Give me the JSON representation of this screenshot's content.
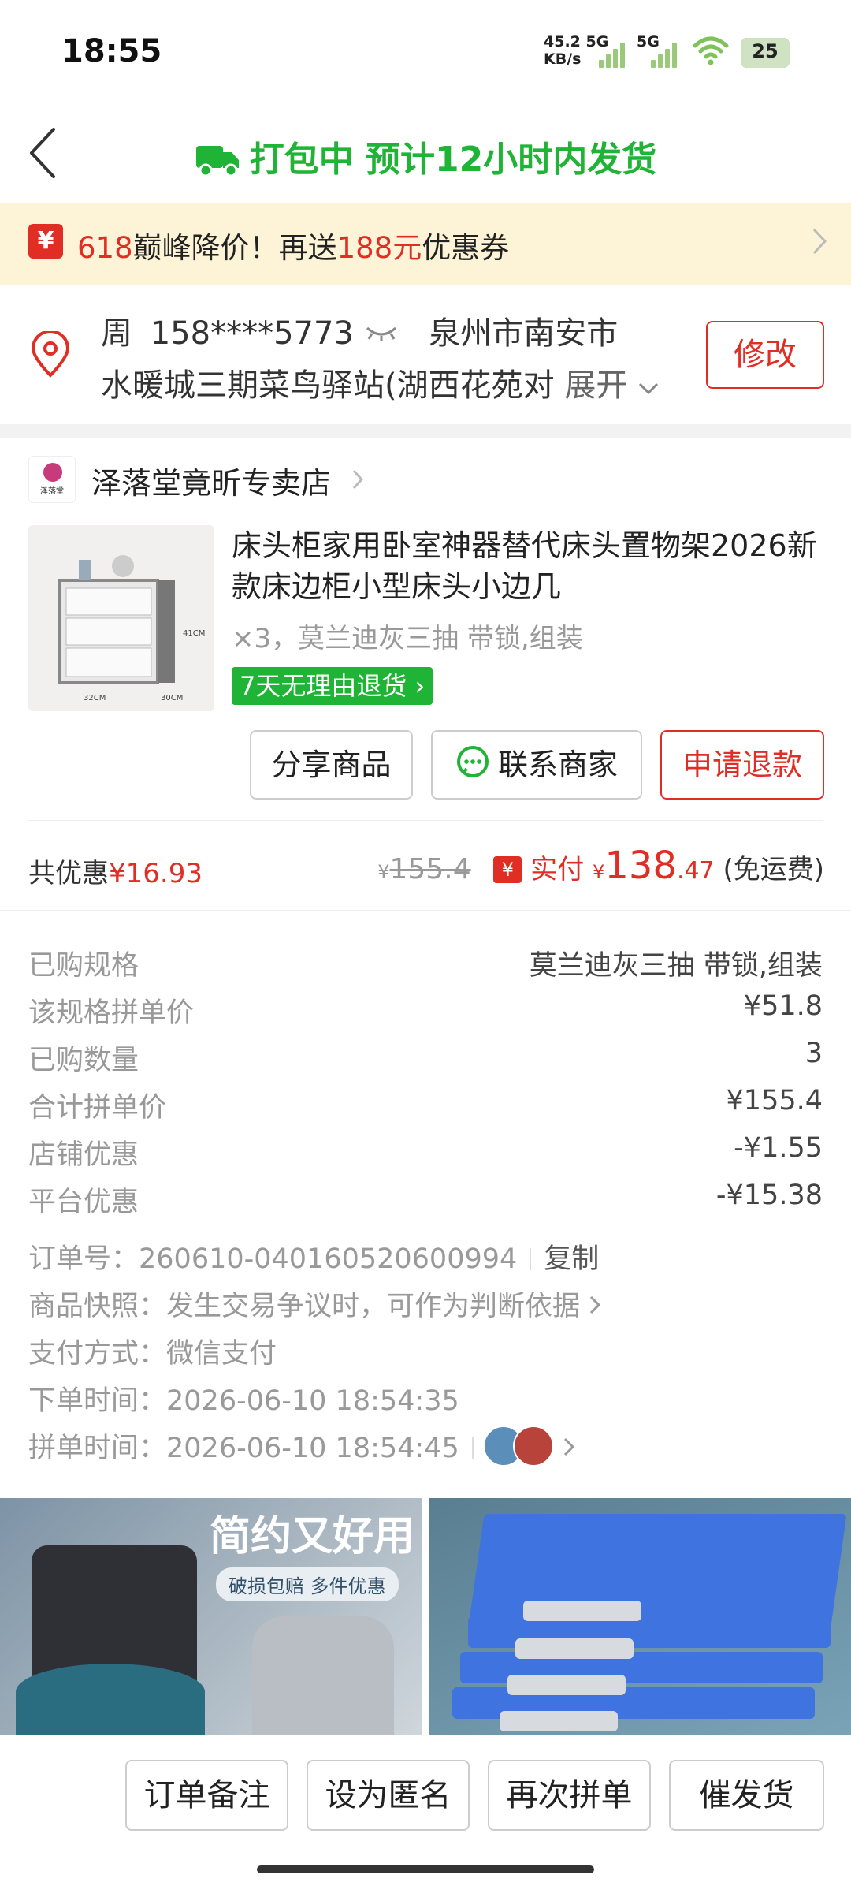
{
  "status_bar": {
    "time": "18:55",
    "net_speed": "45.2",
    "net_unit": "KB/s",
    "sim1": "5G",
    "sim2": "5G",
    "battery": "25"
  },
  "header": {
    "title": "打包中 预计12小时内发货",
    "title_color": "#20b436"
  },
  "promo": {
    "tag_icon": "¥",
    "highlight1": "618",
    "text1": "巅峰降价！再送",
    "highlight2": "188元",
    "text2": "优惠券"
  },
  "address": {
    "name": "周",
    "phone": "158****5773",
    "region": "泉州市南安市",
    "detail": "水暖城三期菜鸟驿站(湖西花苑对",
    "expand": "展开",
    "modify_label": "修改"
  },
  "store": {
    "name": "泽落堂竟昕专卖店",
    "logo_text": "泽落堂"
  },
  "product": {
    "title": "床头柜家用卧室神器替代床头置物架2026新款床边柜小型床头小边几",
    "spec": "×3，莫兰迪灰三抽 带锁,组装",
    "return_policy": "7天无理由退货",
    "img_label_w": "32CM",
    "img_label_d": "30CM",
    "img_label_h": "41CM"
  },
  "actions": {
    "share": "分享商品",
    "contact": "联系商家",
    "refund": "申请退款"
  },
  "summary": {
    "discount_label": "共优惠",
    "discount_value": "¥16.93",
    "currency": "¥",
    "original_price": "155.4",
    "pay_icon": "¥",
    "paid_label": "实付",
    "paid_int": "138",
    "paid_dec": ".47",
    "shipping_note": "(免运费)"
  },
  "details": [
    {
      "label": "已购规格",
      "value": "莫兰迪灰三抽 带锁,组装"
    },
    {
      "label": "该规格拼单价",
      "value": "¥51.8"
    },
    {
      "label": "已购数量",
      "value": "3"
    },
    {
      "label": "合计拼单价",
      "value": "¥155.4"
    },
    {
      "label": "店铺优惠",
      "value": "-¥1.55"
    },
    {
      "label": "平台优惠",
      "value": "-¥15.38"
    }
  ],
  "order_info": {
    "order_no_label": "订单号：",
    "order_no": "260610-040160520600994",
    "copy_label": "复制",
    "snapshot_label": "商品快照：",
    "snapshot_value": "发生交易争议时，可作为判断依据",
    "payment_label": "支付方式：",
    "payment_value": "微信支付",
    "order_time_label": "下单时间：",
    "order_time": "2026-06-10 18:54:35",
    "group_time_label": "拼单时间：",
    "group_time": "2026-06-10 18:54:45"
  },
  "banners": {
    "banner1_title": "简约又好用",
    "banner1_sub": "破损包赔  多件优惠"
  },
  "bottom_bar": {
    "note": "订单备注",
    "anonymous": "设为匿名",
    "regroup": "再次拼单",
    "urge": "催发货"
  },
  "colors": {
    "accent_red": "#e02e24",
    "accent_green": "#20b436",
    "promo_bg": "#fdf3d6"
  }
}
